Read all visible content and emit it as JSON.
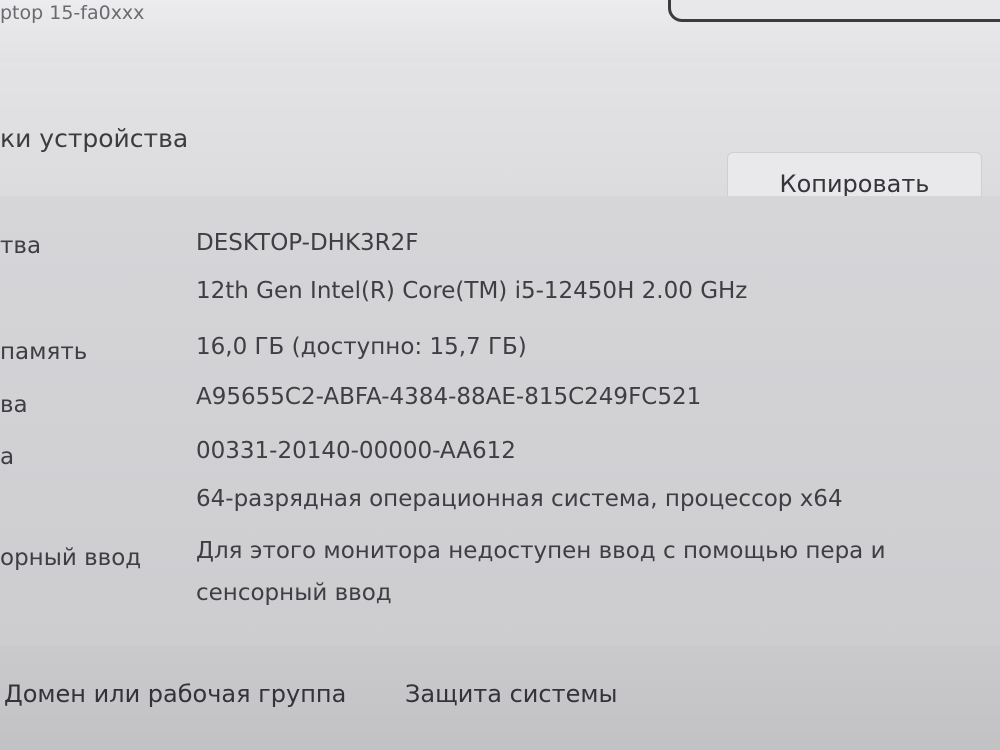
{
  "header": {
    "device_model": "ptop 15-fa0xxx"
  },
  "specs_section": {
    "title": "ки устройства",
    "copy_button": "Копировать"
  },
  "specs": [
    {
      "label": "тва",
      "value": "DESKTOP-DHK3R2F"
    },
    {
      "label": "",
      "value": "12th Gen Intel(R) Core(TM) i5-12450H   2.00 GHz"
    },
    {
      "label": "память",
      "value": "16,0 ГБ (доступно: 15,7 ГБ)"
    },
    {
      "label": "ва",
      "value": "A95655C2-ABFA-4384-88AE-815C249FC521"
    },
    {
      "label": "а",
      "value": "00331-20140-00000-AA612"
    },
    {
      "label": "",
      "value": "64-разрядная операционная система, процессор x64"
    },
    {
      "label": "орный ввод",
      "value_line1": "Для этого монитора недоступен ввод с помощью пера и",
      "value_line2": "сенсорный ввод"
    }
  ],
  "related_links": {
    "domain": "Домен или рабочая группа",
    "system_protection": "Защита системы"
  }
}
